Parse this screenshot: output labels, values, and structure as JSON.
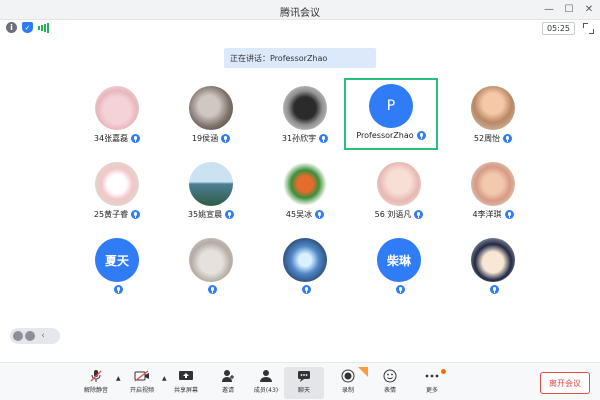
{
  "window": {
    "title": "腾讯会议"
  },
  "status": {
    "timer": "05:25"
  },
  "speaking": {
    "text": "正在讲话：ProfessorZhao"
  },
  "participants": [
    {
      "name": "34张嘉磊",
      "avatar": "photo-cartoon-pig"
    },
    {
      "name": "19侯涵",
      "avatar": "photo-anime"
    },
    {
      "name": "31孙欣宇",
      "avatar": "photo-figure"
    },
    {
      "name": "ProfessorZhao",
      "avatar_text": "P",
      "active": true
    },
    {
      "name": "52周怡",
      "avatar": "photo-baby"
    },
    {
      "name": "25黄子睿",
      "avatar": "photo-anime-girl"
    },
    {
      "name": "35姚宣晨",
      "avatar": "photo-landscape"
    },
    {
      "name": "45吴冰",
      "avatar": "photo-toy"
    },
    {
      "name": "56 刘语凡",
      "avatar": "photo-baby"
    },
    {
      "name": "4李洋琪",
      "avatar": "photo-baby"
    },
    {
      "name": "",
      "avatar_text": "夏天"
    },
    {
      "name": "",
      "avatar": "photo-animal"
    },
    {
      "name": "",
      "avatar": "photo-light"
    },
    {
      "name": "",
      "avatar_text": "柴琳"
    },
    {
      "name": "",
      "avatar": "photo-cartoon"
    }
  ],
  "toolbar": {
    "mute": "解除静音",
    "video": "开启视频",
    "share": "共享屏幕",
    "invite": "邀请",
    "members": "成员(43)",
    "chat": "聊天",
    "record": "录制",
    "reactions": "表情",
    "more": "更多",
    "end": "离开会议"
  },
  "colors": {
    "accent": "#2f7cf6",
    "active_border": "#27c07c",
    "end": "#e64a4a"
  }
}
